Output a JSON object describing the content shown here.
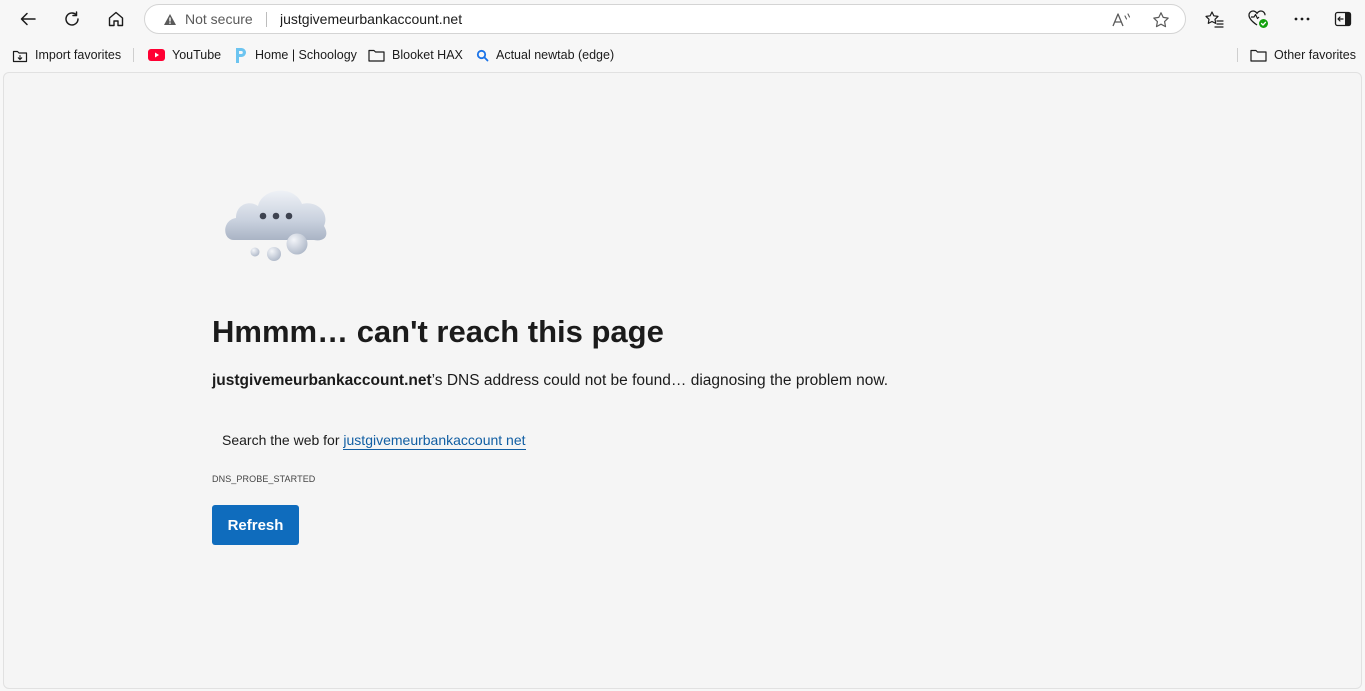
{
  "address_bar": {
    "security_label": "Not secure",
    "url": "justgivemeurbankaccount.net"
  },
  "favorites": {
    "items": [
      {
        "label": "Import favorites",
        "icon": "import-favorites-icon"
      },
      {
        "label": "YouTube",
        "icon": "youtube-icon"
      },
      {
        "label": "Home | Schoology",
        "icon": "schoology-icon"
      },
      {
        "label": "Blooket HAX",
        "icon": "folder-icon"
      },
      {
        "label": "Actual newtab (edge)",
        "icon": "search-icon"
      }
    ],
    "other": {
      "label": "Other favorites",
      "icon": "folder-icon"
    }
  },
  "error_page": {
    "title": "Hmmm… can't reach this page",
    "domain": "justgivemeurbankaccount.net",
    "message": "’s DNS address could not be found… diagnosing the problem now.",
    "search_prefix": "Search the web for ",
    "search_link": "justgivemeurbankaccount net",
    "error_code": "DNS_PROBE_STARTED",
    "refresh_label": "Refresh"
  },
  "colors": {
    "accent": "#0f6cbd",
    "link": "#115ea3",
    "youtube": "#ff0033",
    "schoology": "#6cc4f0"
  }
}
